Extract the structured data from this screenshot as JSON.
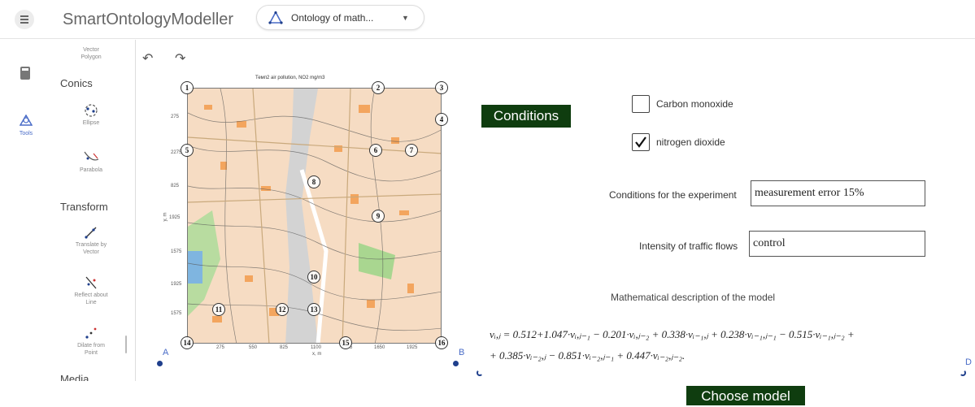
{
  "app": {
    "title": "SmartOntologyModeller"
  },
  "document_select": {
    "label": "Ontology of math...",
    "icon": "triangle-tool-icon"
  },
  "rail": {
    "tools_label": "Tools"
  },
  "tools_panel": {
    "vector_polygon": "Vector\nPolygon",
    "conics_heading": "Conics",
    "ellipse": "Ellipse",
    "parabola": "Parabola",
    "transform_heading": "Transform",
    "translate": "Translate by\nVector",
    "reflect": "Reflect about\nLine",
    "dilate": "Dilate from\nPoint",
    "media_heading": "Media"
  },
  "map": {
    "title": "Темп2 air pollution, NO2 mg/m3",
    "y_ticks": [
      "2275",
      "1925",
      "1575",
      "1925",
      "1575",
      "275",
      "825"
    ],
    "y_label": "y, m",
    "x_ticks": [
      "275",
      "550",
      "825",
      "1100",
      "1375",
      "1650",
      "1925"
    ],
    "x_label": "x, m",
    "markers": [
      "1",
      "2",
      "3",
      "4",
      "5",
      "6",
      "7",
      "8",
      "9",
      "10",
      "11",
      "12",
      "13",
      "14",
      "15",
      "16"
    ]
  },
  "points": {
    "a": "A",
    "b": "B",
    "d": "D"
  },
  "conditions": {
    "button": "Conditions",
    "co_label": "Carbon monoxide",
    "co_checked": false,
    "no2_label": "nitrogen dioxide",
    "no2_checked": true
  },
  "experiment": {
    "label": "Conditions for the experiment",
    "value": "measurement  error  15%"
  },
  "traffic": {
    "label": "Intensity of traffic flows",
    "value": "control"
  },
  "model": {
    "label": "Mathematical description of the model",
    "formula_line1": "vᵢ,ⱼ = 0.512+1.047·vᵢ,ⱼ₋₁ − 0.201·vᵢ,ⱼ₋₂ + 0.338·vᵢ₋₁,ⱼ + 0.238·vᵢ₋₁,ⱼ₋₁ − 0.515·vᵢ₋₁,ⱼ₋₂ +",
    "formula_line2": "+ 0.385·vᵢ₋₂,ⱼ − 0.851·vᵢ₋₂,ⱼ₋₁ + 0.447·vᵢ₋₂,ⱼ₋₂.",
    "choose_button": "Choose model"
  },
  "colors": {
    "accent": "#0f3d0f",
    "point": "#1f3f8c",
    "link": "#4a6cc7"
  }
}
